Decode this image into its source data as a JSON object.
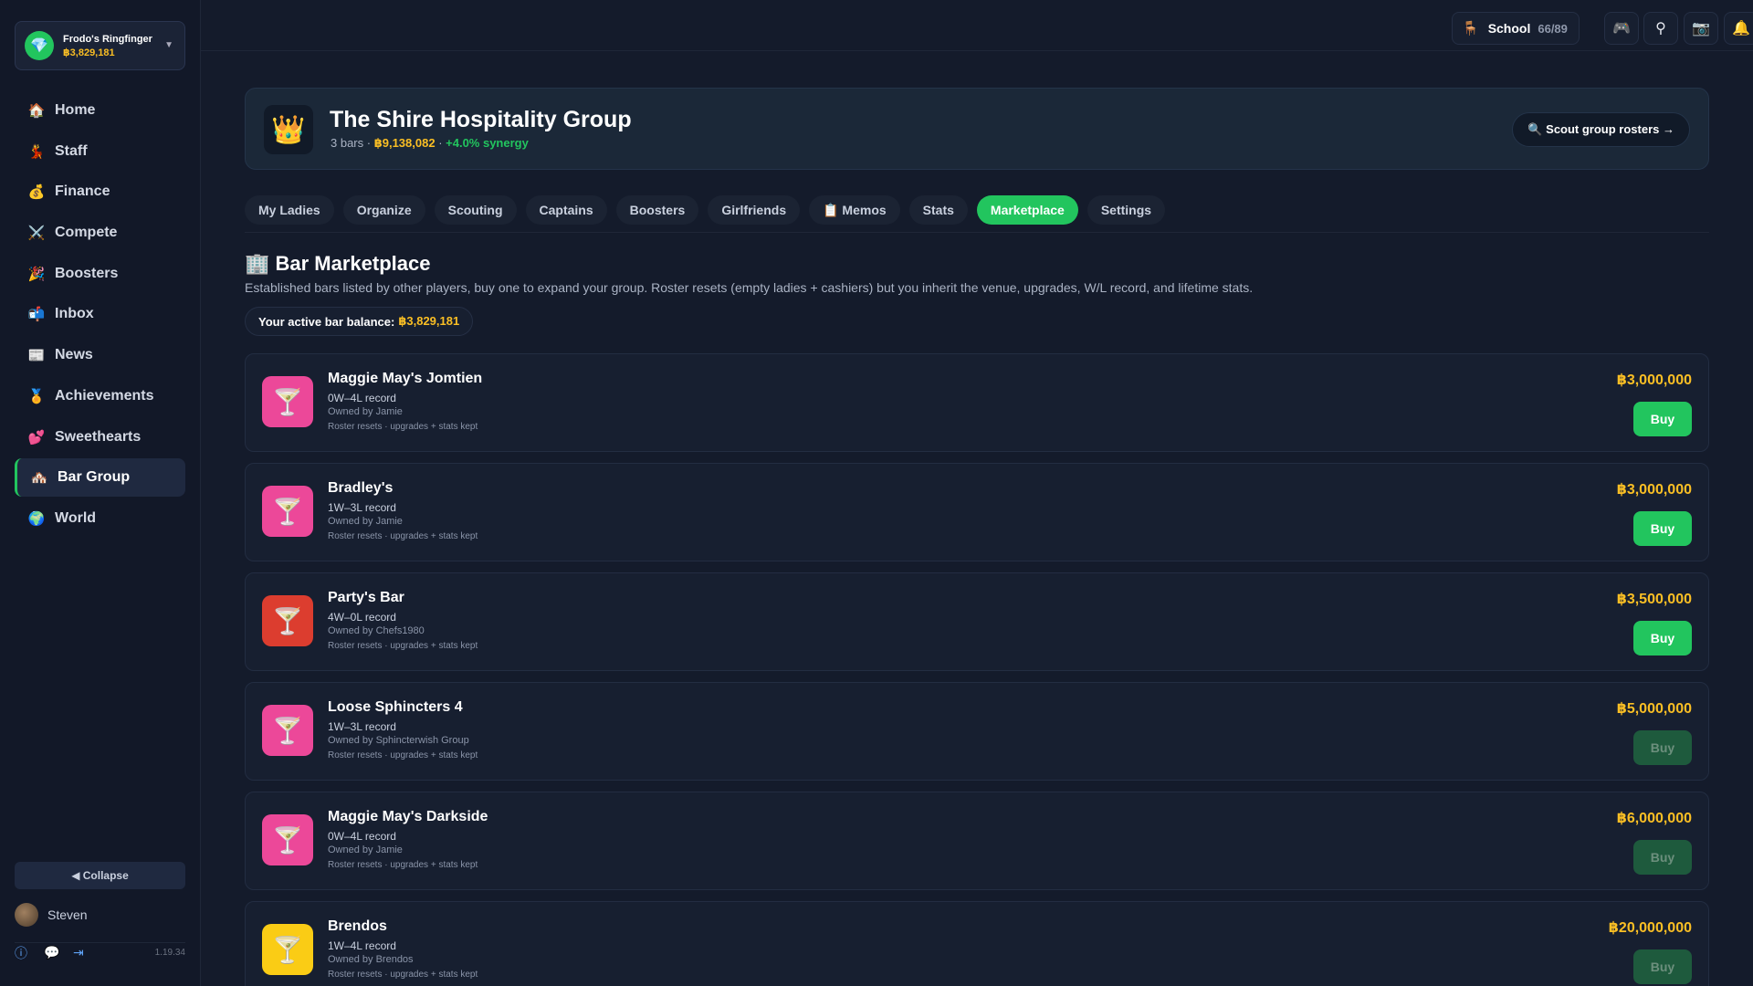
{
  "sidebar": {
    "bar_name": "Frodo's Ringfinger",
    "bar_balance": "฿3,829,181",
    "items": [
      {
        "icon": "🏠",
        "label": "Home"
      },
      {
        "icon": "💃",
        "label": "Staff"
      },
      {
        "icon": "💰",
        "label": "Finance"
      },
      {
        "icon": "⚔️",
        "label": "Compete"
      },
      {
        "icon": "🎉",
        "label": "Boosters"
      },
      {
        "icon": "📬",
        "label": "Inbox"
      },
      {
        "icon": "📰",
        "label": "News"
      },
      {
        "icon": "🏅",
        "label": "Achievements"
      },
      {
        "icon": "💕",
        "label": "Sweethearts"
      },
      {
        "icon": "🏘️",
        "label": "Bar Group",
        "active": true
      },
      {
        "icon": "🌍",
        "label": "World"
      }
    ],
    "collapse_label": "◀ Collapse",
    "user_name": "Steven",
    "version": "1.19.34"
  },
  "topbar": {
    "school_label": "School",
    "school_count": "66/89"
  },
  "group": {
    "title": "The Shire Hospitality Group",
    "bars": "3 bars · ",
    "value": "฿9,138,082",
    "sep": " · ",
    "synergy": "+4.0% synergy",
    "scout_label": "🔍 Scout group rosters →"
  },
  "tabs": [
    "My Ladies",
    "Organize",
    "Scouting",
    "Captains",
    "Boosters",
    "Girlfriends",
    "📋 Memos",
    "Stats",
    "Marketplace",
    "Settings"
  ],
  "active_tab": "Marketplace",
  "marketplace": {
    "title": "🏢 Bar Marketplace",
    "description": "Established bars listed by other players, buy one to expand your group. Roster resets (empty ladies + cashiers) but you inherit the venue, upgrades, W/L record, and lifetime stats.",
    "balance_label": "Your active bar balance:",
    "balance_value": "฿3,829,181",
    "buy_label": "Buy",
    "listings": [
      {
        "name": "Maggie May's Jomtien",
        "record": "0W–4L record",
        "owner": "Owned by Jamie",
        "note": "Roster resets · upgrades + stats kept",
        "price": "฿3,000,000",
        "color": "#ec4899",
        "affordable": true
      },
      {
        "name": "Bradley's",
        "record": "1W–3L record",
        "owner": "Owned by Jamie",
        "note": "Roster resets · upgrades + stats kept",
        "price": "฿3,000,000",
        "color": "#ec4899",
        "affordable": true
      },
      {
        "name": "Party's Bar",
        "record": "4W–0L record",
        "owner": "Owned by Chefs1980",
        "note": "Roster resets · upgrades + stats kept",
        "price": "฿3,500,000",
        "color": "#dc3d2f",
        "affordable": true
      },
      {
        "name": "Loose Sphincters 4",
        "record": "1W–3L record",
        "owner": "Owned by Sphincterwish Group",
        "note": "Roster resets · upgrades + stats kept",
        "price": "฿5,000,000",
        "color": "#ec4899",
        "affordable": false
      },
      {
        "name": "Maggie May's Darkside",
        "record": "0W–4L record",
        "owner": "Owned by Jamie",
        "note": "Roster resets · upgrades + stats kept",
        "price": "฿6,000,000",
        "color": "#ec4899",
        "affordable": false
      },
      {
        "name": "Brendos",
        "record": "1W–4L record",
        "owner": "Owned by Brendos",
        "note": "Roster resets · upgrades + stats kept",
        "price": "฿20,000,000",
        "color": "#facc15",
        "affordable": false
      }
    ]
  }
}
